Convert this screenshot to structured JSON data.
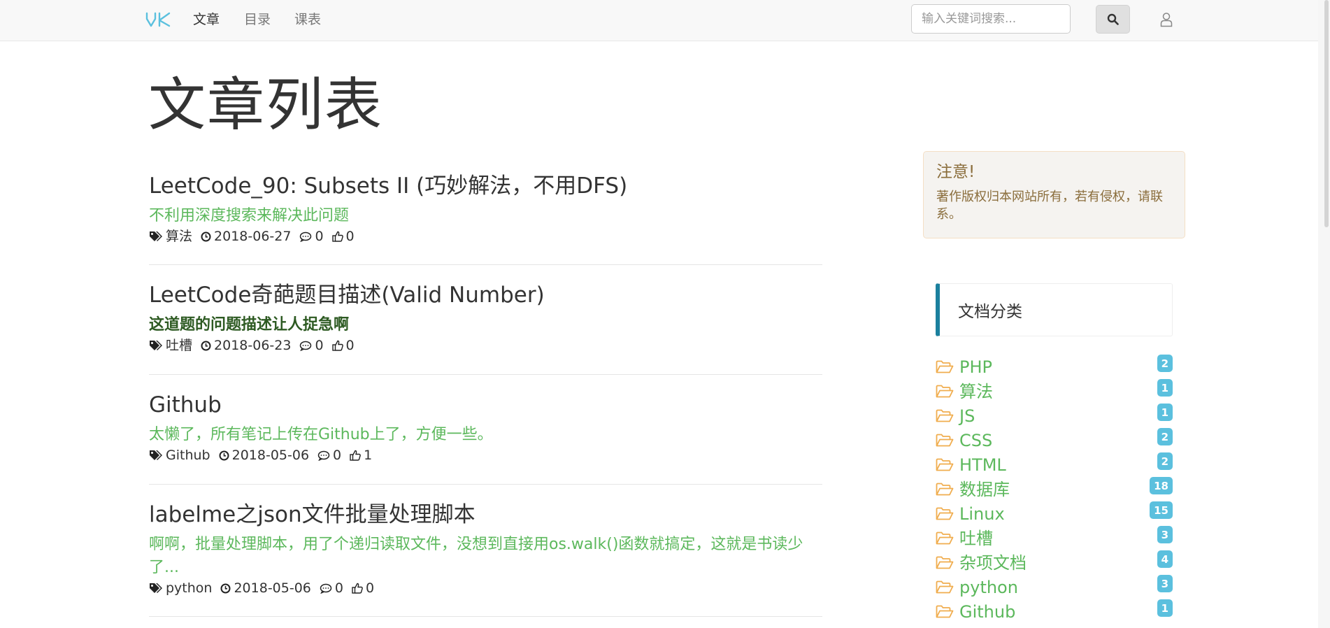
{
  "nav": {
    "links": [
      "文章",
      "目录",
      "课表"
    ],
    "search_placeholder": "输入关键词搜索..."
  },
  "page": {
    "title": "文章列表"
  },
  "articles": [
    {
      "title": "LeetCode_90: Subsets II (巧妙解法，不用DFS)",
      "summary": "不利用深度搜索来解决此问题",
      "tag": "算法",
      "date": "2018-06-27",
      "comments": "0",
      "likes": "0"
    },
    {
      "title": "LeetCode奇葩题目描述(Valid Number)",
      "summary": "这道题的问题描述让人捉急啊",
      "tag": "吐槽",
      "date": "2018-06-23",
      "comments": "0",
      "likes": "0"
    },
    {
      "title": "Github",
      "summary": "太懒了，所有笔记上传在Github上了，方便一些。",
      "tag": "Github",
      "date": "2018-05-06",
      "comments": "0",
      "likes": "1"
    },
    {
      "title": "labelme之json文件批量处理脚本",
      "summary": "啊啊，批量处理脚本，用了个递归读取文件，没想到直接用os.walk()函数就搞定，这就是书读少了...",
      "tag": "python",
      "date": "2018-05-06",
      "comments": "0",
      "likes": "0"
    }
  ],
  "notice": {
    "title": "注意!",
    "body": "著作版权归本网站所有，若有侵权，请联系。"
  },
  "categories": {
    "header": "文档分类",
    "items": [
      {
        "name": "PHP",
        "count": "2"
      },
      {
        "name": "算法",
        "count": "1"
      },
      {
        "name": "JS",
        "count": "1"
      },
      {
        "name": "CSS",
        "count": "2"
      },
      {
        "name": "HTML",
        "count": "2"
      },
      {
        "name": "数据库",
        "count": "18"
      },
      {
        "name": "Linux",
        "count": "15"
      },
      {
        "name": "吐槽",
        "count": "3"
      },
      {
        "name": "杂项文档",
        "count": "4"
      },
      {
        "name": "python",
        "count": "3"
      },
      {
        "name": "Github",
        "count": "1"
      }
    ]
  },
  "colors": {
    "link_green": "#5cb85c",
    "badge": "#5bc0de",
    "notice_text": "#8a6d3b",
    "category_accent": "#1b809e",
    "logo": "#5bc0de"
  },
  "icons": {
    "tag": "tags-icon",
    "date": "clock-icon",
    "comments": "comment-icon",
    "likes": "thumbs-up-icon",
    "category": "folder-open-icon",
    "search": "search-icon",
    "user": "user-icon"
  }
}
